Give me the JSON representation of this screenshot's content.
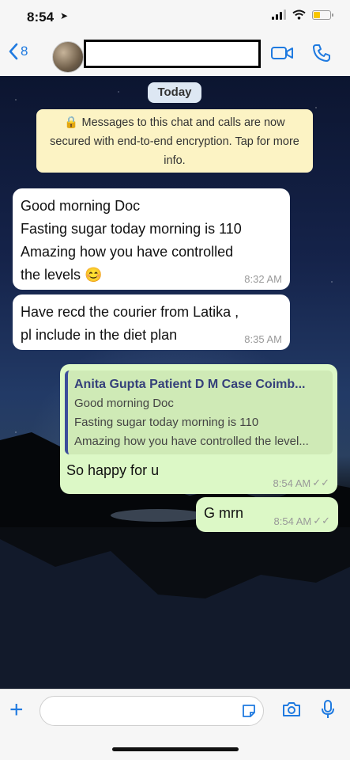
{
  "status_bar": {
    "time": "8:54",
    "location_icon": "location-arrow-icon",
    "battery_level": 0.4,
    "battery_color": "#f7c600"
  },
  "header": {
    "back_count": "8",
    "accent": "#1f7ae0",
    "icons": [
      "video-call-icon",
      "phone-icon"
    ]
  },
  "chat": {
    "date_label": "Today",
    "encryption_notice": "Messages to this chat and calls are now secured with end-to-end encryption. Tap for more info.",
    "messages": [
      {
        "direction": "incoming",
        "lines": [
          "Good morning Doc",
          "Fasting sugar today morning is 110",
          "Amazing how you have controlled",
          "the levels 😊"
        ],
        "time": "8:32 AM"
      },
      {
        "direction": "incoming",
        "lines": [
          "Have recd the courier from Latika ,",
          "pl include in the diet plan"
        ],
        "time": "8:35 AM"
      },
      {
        "direction": "outgoing",
        "quote": {
          "author": "Anita Gupta Patient D M Case Coimb...",
          "lines": [
            "Good morning Doc",
            "Fasting sugar today morning is 110",
            "Amazing how you have controlled the level..."
          ]
        },
        "text": "So happy for u",
        "time": "8:54 AM"
      },
      {
        "direction": "outgoing",
        "text": "G mrn",
        "time": "8:54 AM"
      }
    ]
  },
  "composer": {
    "placeholder": "",
    "icons": [
      "plus-icon",
      "sticker-icon",
      "camera-icon",
      "microphone-icon"
    ]
  }
}
